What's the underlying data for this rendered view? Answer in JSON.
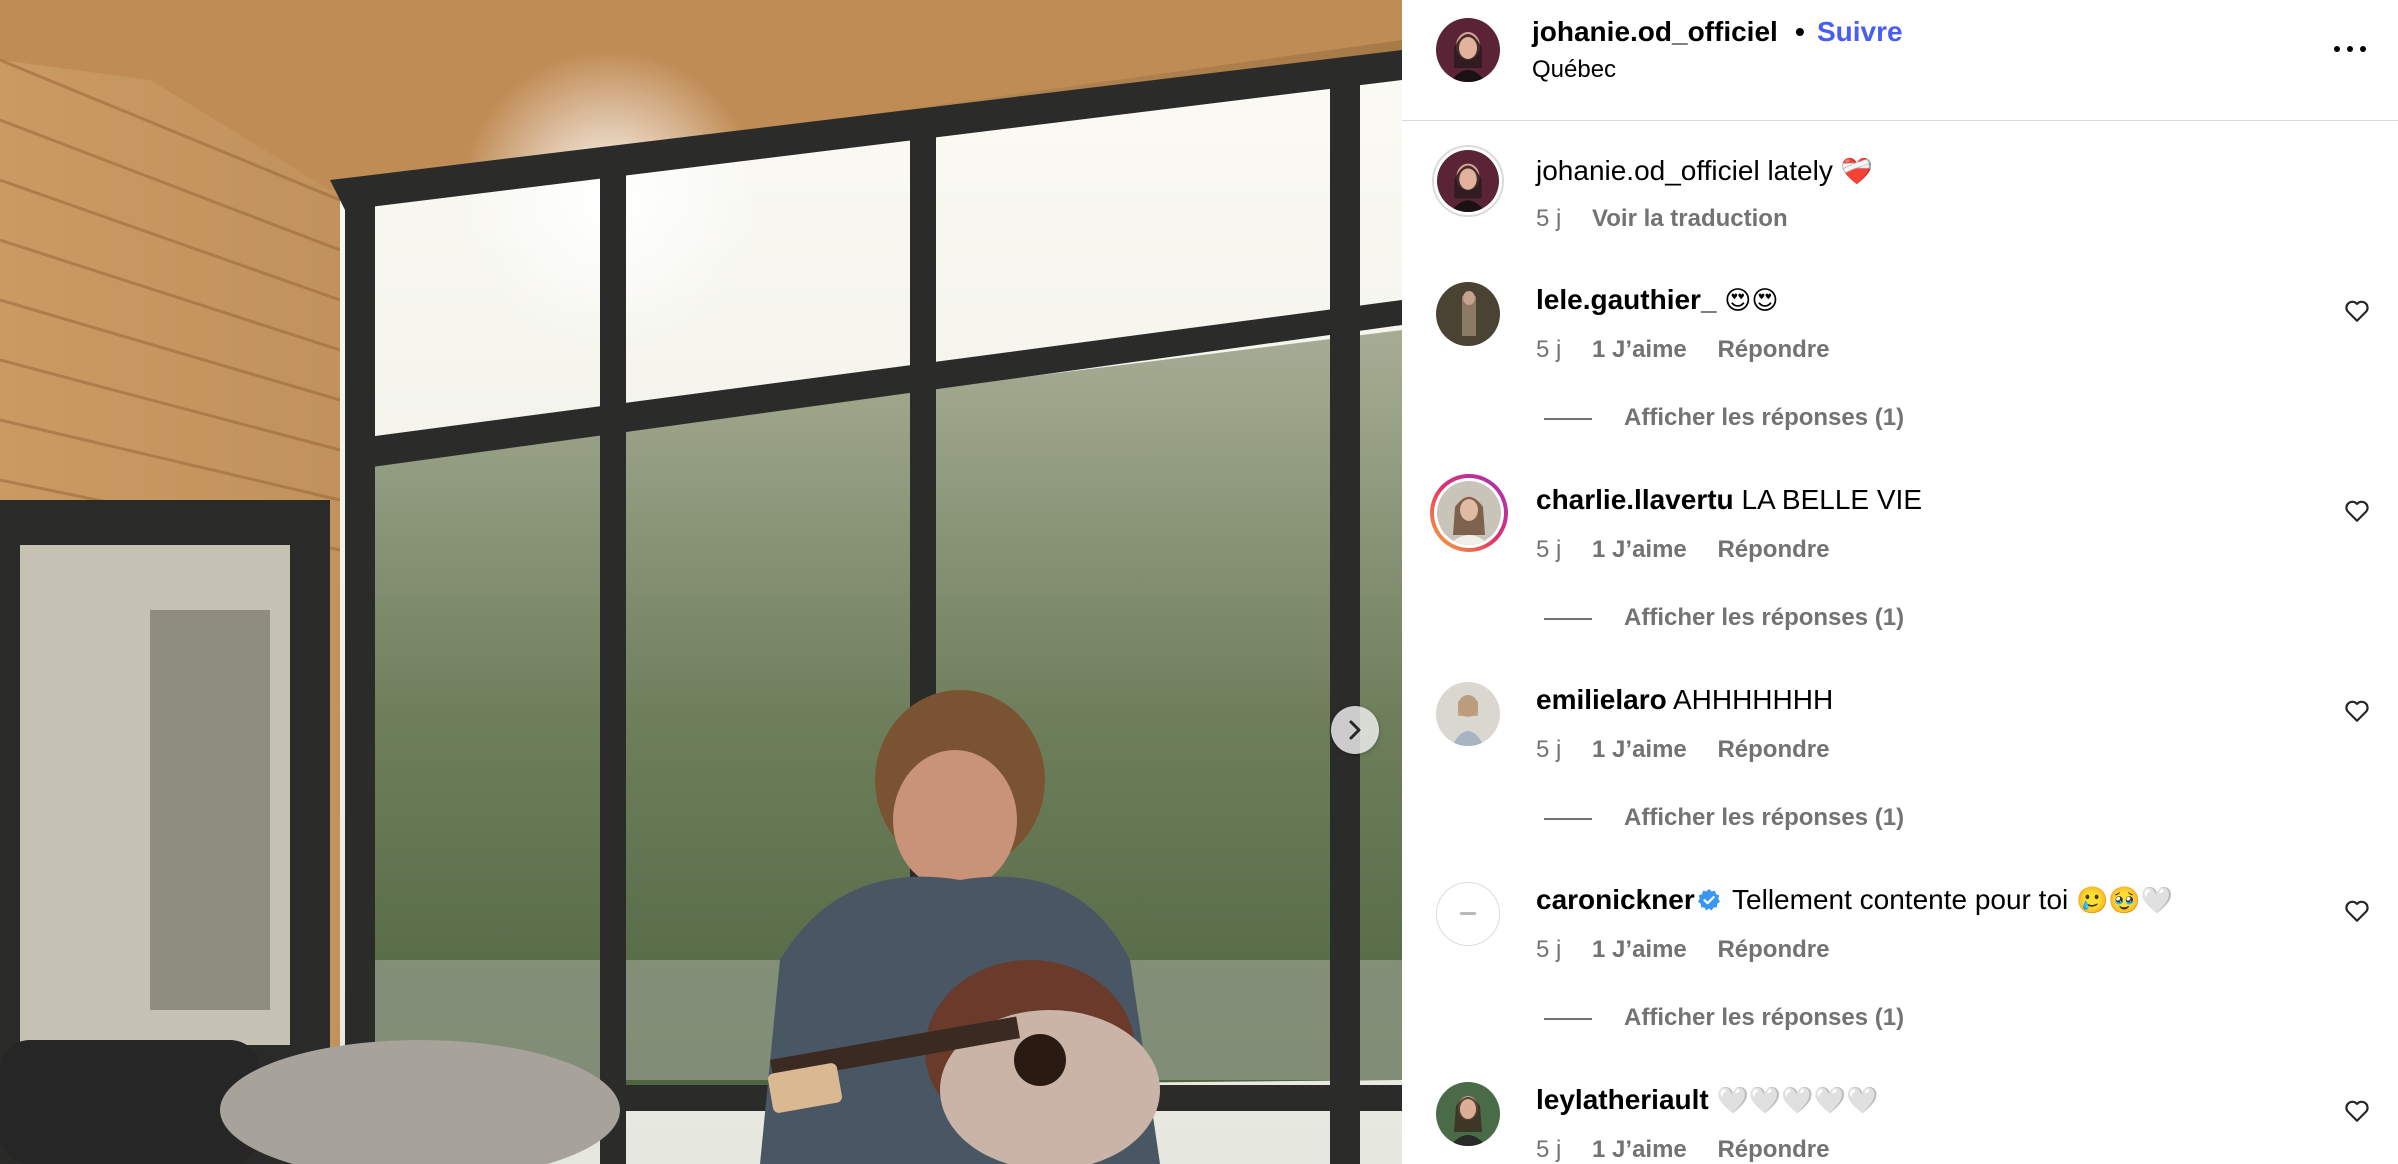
{
  "post": {
    "username": "johanie.od_officiel",
    "separator": "•",
    "follow_label": "Suivre",
    "location": "Québec"
  },
  "caption": {
    "username": "johanie.od_officiel",
    "text": "lately",
    "emoji": "❤️‍🩹",
    "time": "5 j",
    "translate_label": "Voir la traduction"
  },
  "comments": [
    {
      "username": "lele.gauthier_",
      "text": "😍😍",
      "time": "5 j",
      "likes": "1 J’aime",
      "reply": "Répondre",
      "show_replies": "Afficher les réponses (1)"
    },
    {
      "username": "charlie.llavertu",
      "text": "LA BELLE VIE",
      "time": "5 j",
      "likes": "1 J’aime",
      "reply": "Répondre",
      "show_replies": "Afficher les réponses (1)"
    },
    {
      "username": "emilielaro",
      "text": "AHHHHHHH",
      "time": "5 j",
      "likes": "1 J’aime",
      "reply": "Répondre",
      "show_replies": "Afficher les réponses (1)"
    },
    {
      "username": "caronickner",
      "text": "Tellement contente pour toi",
      "emoji": "🥲🥹🤍",
      "time": "5 j",
      "likes": "1 J’aime",
      "reply": "Répondre",
      "show_replies": "Afficher les réponses (1)"
    },
    {
      "username": "leylatheriault",
      "text": "🤍🤍🤍🤍🤍",
      "time": "5 j",
      "likes": "1 J’aime",
      "reply": "Répondre"
    }
  ],
  "icons": {
    "more": "more-horizontal-icon",
    "heart": "heart-outline-icon",
    "next": "chevron-right-icon",
    "verified": "verified-badge-icon"
  },
  "colors": {
    "follow": "#4a5cf2",
    "secondary_text": "#737373",
    "divider": "#dbdbdb",
    "verified": "#3897f0"
  }
}
